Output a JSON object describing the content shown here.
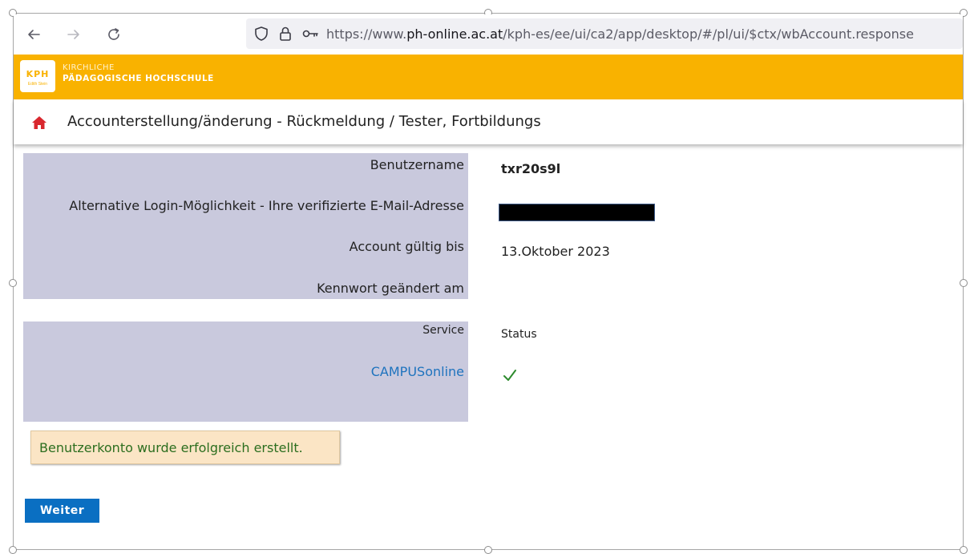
{
  "browser": {
    "url_prefix": "https://www.",
    "url_domain": "ph-online.ac.at",
    "url_path": "/kph-es/ee/ui/ca2/app/desktop/#/pl/ui/$ctx/wbAccount.response"
  },
  "brand": {
    "logo_letters": "KPH",
    "logo_sub": "Edith Stein",
    "school_line1": "KIRCHLICHE",
    "school_line2": "PÄDAGOGISCHE HOCHSCHULE",
    "banner_color": "#f9b200"
  },
  "header": {
    "title": "Accounterstellung/änderung - Rückmeldung",
    "subtitle": " / Tester, Fortbildungs"
  },
  "account": {
    "username_label": "Benutzername",
    "username_value": "txr20s9l",
    "email_label": "Alternative Login-Möglichkeit - Ihre verifizierte E-Mail-Adresse",
    "valid_label": "Account gültig bis",
    "valid_value": "13.Oktober 2023",
    "password_label": "Kennwort geändert am"
  },
  "services": {
    "service_header": "Service",
    "status_header": "Status",
    "rows": [
      {
        "name": "CAMPUSonline",
        "status_icon": "check-icon"
      }
    ]
  },
  "message": "Benutzerkonto wurde erfolgreich erstellt.",
  "buttons": {
    "next": "Weiter"
  },
  "colors": {
    "panel": "#c9c9dd",
    "link": "#1e73be",
    "success_text": "#2c6e1f",
    "button": "#0a6fc2",
    "home_icon": "#d9272e"
  }
}
